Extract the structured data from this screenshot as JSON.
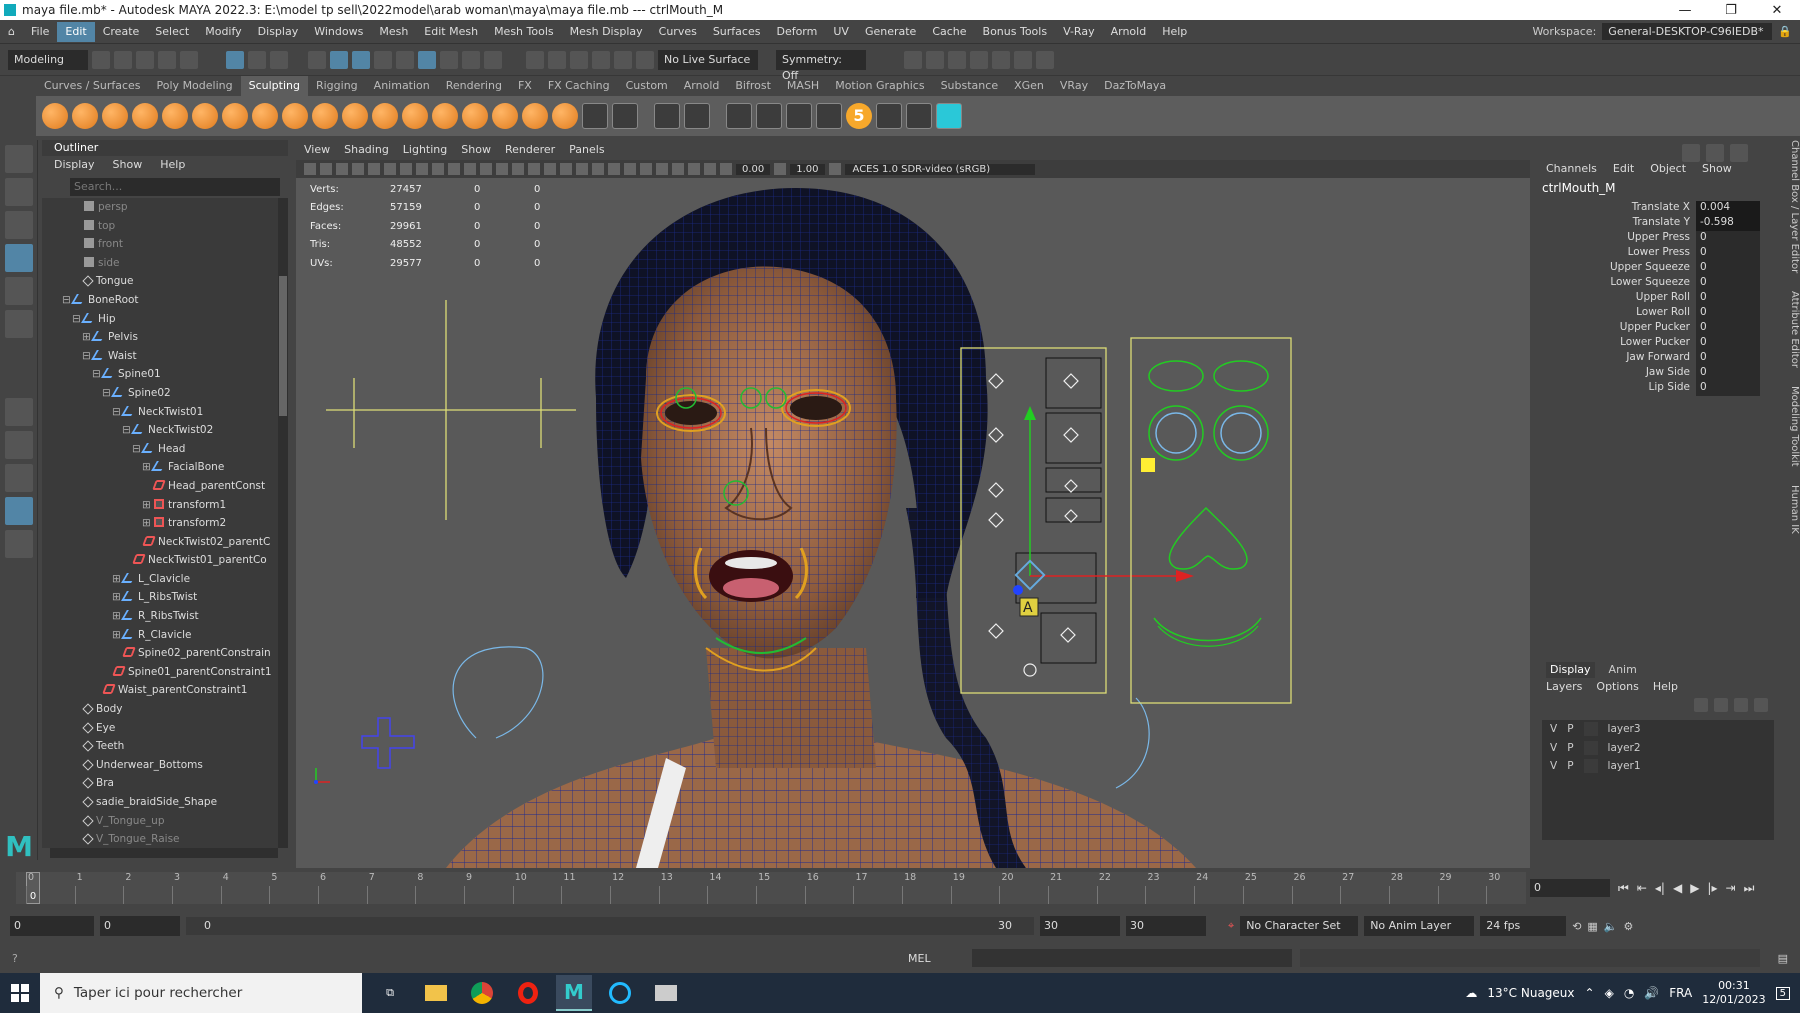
{
  "window": {
    "title": "maya file.mb* - Autodesk MAYA 2022.3: E:\\model tp sell\\2022model\\arab woman\\maya\\maya file.mb  ---  ctrlMouth_M",
    "controls": [
      "—",
      "❐",
      "✕"
    ]
  },
  "menubar": {
    "items": [
      "File",
      "Edit",
      "Create",
      "Select",
      "Modify",
      "Display",
      "Windows",
      "Mesh",
      "Edit Mesh",
      "Mesh Tools",
      "Mesh Display",
      "Curves",
      "Surfaces",
      "Deform",
      "UV",
      "Generate",
      "Cache",
      "Bonus Tools",
      "V-Ray",
      "Arnold",
      "Help"
    ],
    "active": "Edit",
    "workspace_label": "Workspace:",
    "workspace_value": "General-DESKTOP-C96IEDB*"
  },
  "statusline": {
    "mode": "Modeling",
    "live_surface": "No Live Surface",
    "symmetry": "Symmetry: Off"
  },
  "shelf": {
    "tabs": [
      "Curves / Surfaces",
      "Poly Modeling",
      "Sculpting",
      "Rigging",
      "Animation",
      "Rendering",
      "FX",
      "FX Caching",
      "Custom",
      "Arnold",
      "Bifrost",
      "MASH",
      "Motion Graphics",
      "Substance",
      "XGen",
      "VRay",
      "DazToMaya"
    ],
    "active": "Sculpting",
    "badge": "5"
  },
  "outliner": {
    "title": "Outliner",
    "menu": [
      "Display",
      "Show",
      "Help"
    ],
    "search_placeholder": "Search...",
    "rows": [
      {
        "label": "persp",
        "indent": 3,
        "icon": "cam",
        "dim": true
      },
      {
        "label": "top",
        "indent": 3,
        "icon": "cam",
        "dim": true
      },
      {
        "label": "front",
        "indent": 3,
        "icon": "cam",
        "dim": true
      },
      {
        "label": "side",
        "indent": 3,
        "icon": "cam",
        "dim": true
      },
      {
        "label": "Tongue",
        "indent": 3,
        "icon": "grp",
        "dim": false
      },
      {
        "label": "BoneRoot",
        "indent": 2,
        "icon": "jnt",
        "dim": false,
        "toggle": "⊟"
      },
      {
        "label": "Hip",
        "indent": 3,
        "icon": "jnt",
        "dim": false,
        "toggle": "⊟"
      },
      {
        "label": "Pelvis",
        "indent": 4,
        "icon": "jnt",
        "dim": false,
        "toggle": "⊞"
      },
      {
        "label": "Waist",
        "indent": 4,
        "icon": "jnt",
        "dim": false,
        "toggle": "⊟"
      },
      {
        "label": "Spine01",
        "indent": 5,
        "icon": "jnt",
        "dim": false,
        "toggle": "⊟"
      },
      {
        "label": "Spine02",
        "indent": 6,
        "icon": "jnt",
        "dim": false,
        "toggle": "⊟"
      },
      {
        "label": "NeckTwist01",
        "indent": 7,
        "icon": "jnt",
        "dim": false,
        "toggle": "⊟"
      },
      {
        "label": "NeckTwist02",
        "indent": 8,
        "icon": "jnt",
        "dim": false,
        "toggle": "⊟"
      },
      {
        "label": "Head",
        "indent": 9,
        "icon": "jnt",
        "dim": false,
        "toggle": "⊟"
      },
      {
        "label": "FacialBone",
        "indent": 10,
        "icon": "jnt",
        "dim": false,
        "toggle": "⊞"
      },
      {
        "label": "Head_parentConst",
        "indent": 10,
        "icon": "cns",
        "dim": false
      },
      {
        "label": "transform1",
        "indent": 10,
        "icon": "xf",
        "dim": false,
        "toggle": "⊞"
      },
      {
        "label": "transform2",
        "indent": 10,
        "icon": "xf",
        "dim": false,
        "toggle": "⊞"
      },
      {
        "label": "NeckTwist02_parentC",
        "indent": 9,
        "icon": "cns",
        "dim": false
      },
      {
        "label": "NeckTwist01_parentCo",
        "indent": 8,
        "icon": "cns",
        "dim": false
      },
      {
        "label": "L_Clavicle",
        "indent": 7,
        "icon": "jnt",
        "dim": false,
        "toggle": "⊞"
      },
      {
        "label": "L_RibsTwist",
        "indent": 7,
        "icon": "jnt",
        "dim": false,
        "toggle": "⊞"
      },
      {
        "label": "R_RibsTwist",
        "indent": 7,
        "icon": "jnt",
        "dim": false,
        "toggle": "⊞"
      },
      {
        "label": "R_Clavicle",
        "indent": 7,
        "icon": "jnt",
        "dim": false,
        "toggle": "⊞"
      },
      {
        "label": "Spine02_parentConstrain",
        "indent": 7,
        "icon": "cns",
        "dim": false
      },
      {
        "label": "Spine01_parentConstraint1",
        "indent": 6,
        "icon": "cns",
        "dim": false
      },
      {
        "label": "Waist_parentConstraint1",
        "indent": 5,
        "icon": "cns",
        "dim": false
      },
      {
        "label": "Body",
        "indent": 3,
        "icon": "grp",
        "dim": false
      },
      {
        "label": "Eye",
        "indent": 3,
        "icon": "grp",
        "dim": false
      },
      {
        "label": "Teeth",
        "indent": 3,
        "icon": "grp",
        "dim": false
      },
      {
        "label": "Underwear_Bottoms",
        "indent": 3,
        "icon": "grp",
        "dim": false
      },
      {
        "label": "Bra",
        "indent": 3,
        "icon": "grp",
        "dim": false
      },
      {
        "label": "sadie_braidSide_Shape",
        "indent": 3,
        "icon": "grp",
        "dim": false
      },
      {
        "label": "V_Tongue_up",
        "indent": 3,
        "icon": "grp",
        "dim": true
      },
      {
        "label": "V_Tongue_Raise",
        "indent": 3,
        "icon": "grp",
        "dim": true
      }
    ]
  },
  "viewport": {
    "menu": [
      "View",
      "Shading",
      "Lighting",
      "Show",
      "Renderer",
      "Panels"
    ],
    "exposure": "0.00",
    "gamma": "1.00",
    "colorspace": "ACES 1.0 SDR-video (sRGB)",
    "hud": [
      {
        "k": "Verts:",
        "v": "27457",
        "a": "0",
        "b": "0"
      },
      {
        "k": "Edges:",
        "v": "57159",
        "a": "0",
        "b": "0"
      },
      {
        "k": "Faces:",
        "v": "29961",
        "a": "0",
        "b": "0"
      },
      {
        "k": "Tris:",
        "v": "48552",
        "a": "0",
        "b": "0"
      },
      {
        "k": "UVs:",
        "v": "29577",
        "a": "0",
        "b": "0"
      }
    ]
  },
  "channelbox": {
    "menu": [
      "Channels",
      "Edit",
      "Object",
      "Show"
    ],
    "object": "ctrlMouth_M",
    "attrs": [
      {
        "n": "Translate X",
        "v": "0.004",
        "hl": true
      },
      {
        "n": "Translate Y",
        "v": "-0.598",
        "hl": true
      },
      {
        "n": "Upper Press",
        "v": "0"
      },
      {
        "n": "Lower Press",
        "v": "0"
      },
      {
        "n": "Upper Squeeze",
        "v": "0"
      },
      {
        "n": "Lower Squeeze",
        "v": "0"
      },
      {
        "n": "Upper Roll",
        "v": "0"
      },
      {
        "n": "Lower Roll",
        "v": "0"
      },
      {
        "n": "Upper Pucker",
        "v": "0"
      },
      {
        "n": "Lower Pucker",
        "v": "0"
      },
      {
        "n": "Jaw Forward",
        "v": "0"
      },
      {
        "n": "Jaw Side",
        "v": "0"
      },
      {
        "n": "Lip Side",
        "v": "0"
      }
    ],
    "layer_tabs": [
      "Display",
      "Anim"
    ],
    "layer_menu": [
      "Layers",
      "Options",
      "Help"
    ],
    "layers": [
      {
        "v": "V",
        "p": "P",
        "name": "layer3"
      },
      {
        "v": "V",
        "p": "P",
        "name": "layer2"
      },
      {
        "v": "V",
        "p": "P",
        "name": "layer1"
      }
    ],
    "side_tabs": [
      "Channel Box / Layer Editor",
      "Attribute Editor",
      "Modeling Toolkit",
      "Human IK"
    ]
  },
  "timeslider": {
    "ticks": [
      "0",
      "1",
      "2",
      "3",
      "4",
      "5",
      "6",
      "7",
      "8",
      "9",
      "10",
      "11",
      "12",
      "13",
      "14",
      "15",
      "16",
      "17",
      "18",
      "19",
      "20",
      "21",
      "22",
      "23",
      "24",
      "25",
      "26",
      "27",
      "28",
      "29",
      "30"
    ],
    "current": "0",
    "frame_field": "0"
  },
  "range": {
    "start": "0",
    "playback_start": "0",
    "range_start": "0",
    "range_end": "30",
    "playback_end": "30",
    "end": "30",
    "character_set": "No Character Set",
    "anim_layer": "No Anim Layer",
    "fps": "24 fps"
  },
  "cmdline": {
    "lang": "MEL"
  },
  "taskbar": {
    "search_text": "Taper ici pour rechercher",
    "weather": "13°C  Nuageux",
    "lang": "FRA",
    "time": "00:31",
    "date": "12/01/2023",
    "notif": "5"
  }
}
